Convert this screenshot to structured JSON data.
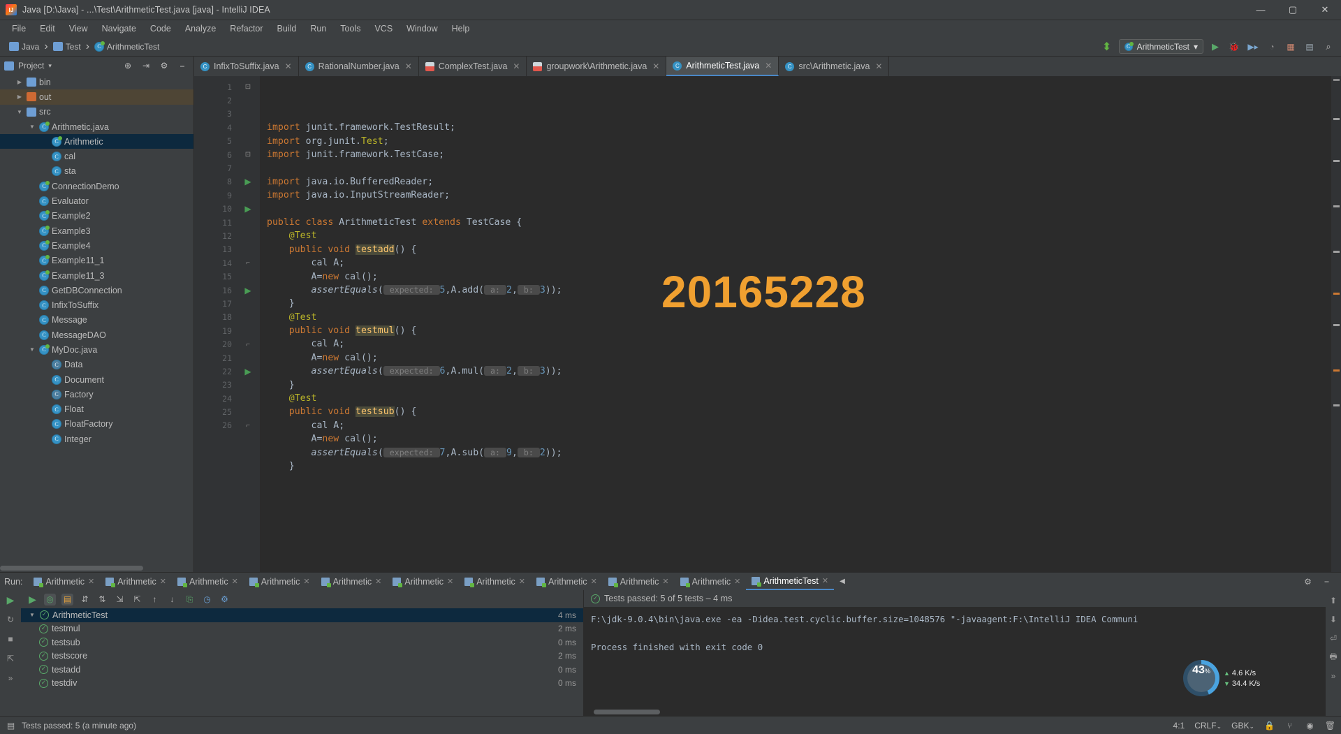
{
  "window": {
    "title": "Java [D:\\Java] - ...\\Test\\ArithmeticTest.java [java] - IntelliJ IDEA",
    "minimize": "—",
    "maximize": "▢",
    "close": "✕"
  },
  "menubar": [
    "File",
    "Edit",
    "View",
    "Navigate",
    "Code",
    "Analyze",
    "Refactor",
    "Build",
    "Run",
    "Tools",
    "VCS",
    "Window",
    "Help"
  ],
  "navbar": {
    "crumbs": [
      "Java",
      "Test",
      "ArithmeticTest"
    ],
    "separator": "›",
    "run_config": "ArithmeticTest",
    "run_config_caret": "▾"
  },
  "project_panel": {
    "title": "Project",
    "title_caret": "▾",
    "tree": [
      {
        "label": "bin",
        "depth": 1,
        "icon": "folder-blue",
        "arrow": "▶",
        "state": "normal"
      },
      {
        "label": "out",
        "depth": 1,
        "icon": "folder-orange",
        "arrow": "▶",
        "state": "tan"
      },
      {
        "label": "src",
        "depth": 1,
        "icon": "folder-blue",
        "arrow": "▼",
        "state": "normal"
      },
      {
        "label": "Arithmetic.java",
        "depth": 2,
        "icon": "class-run",
        "arrow": "▼",
        "state": "normal"
      },
      {
        "label": "Arithmetic",
        "depth": 3,
        "icon": "class-run",
        "arrow": "",
        "state": "selected"
      },
      {
        "label": "cal",
        "depth": 3,
        "icon": "class",
        "arrow": "",
        "state": "normal"
      },
      {
        "label": "sta",
        "depth": 3,
        "icon": "class",
        "arrow": "",
        "state": "normal"
      },
      {
        "label": "ConnectionDemo",
        "depth": 2,
        "icon": "class-run",
        "arrow": "",
        "state": "normal"
      },
      {
        "label": "Evaluator",
        "depth": 2,
        "icon": "class",
        "arrow": "",
        "state": "normal"
      },
      {
        "label": "Example2",
        "depth": 2,
        "icon": "class-run",
        "arrow": "",
        "state": "normal"
      },
      {
        "label": "Example3",
        "depth": 2,
        "icon": "class-run",
        "arrow": "",
        "state": "normal"
      },
      {
        "label": "Example4",
        "depth": 2,
        "icon": "class-run",
        "arrow": "",
        "state": "normal"
      },
      {
        "label": "Example11_1",
        "depth": 2,
        "icon": "class-run",
        "arrow": "",
        "state": "normal"
      },
      {
        "label": "Example11_3",
        "depth": 2,
        "icon": "class-run",
        "arrow": "",
        "state": "normal"
      },
      {
        "label": "GetDBConnection",
        "depth": 2,
        "icon": "class",
        "arrow": "",
        "state": "normal"
      },
      {
        "label": "InfixToSuffix",
        "depth": 2,
        "icon": "class",
        "arrow": "",
        "state": "normal"
      },
      {
        "label": "Message",
        "depth": 2,
        "icon": "class",
        "arrow": "",
        "state": "normal"
      },
      {
        "label": "MessageDAO",
        "depth": 2,
        "icon": "class",
        "arrow": "",
        "state": "normal"
      },
      {
        "label": "MyDoc.java",
        "depth": 2,
        "icon": "class-run",
        "arrow": "▼",
        "state": "normal"
      },
      {
        "label": "Data",
        "depth": 3,
        "icon": "class-dim",
        "arrow": "",
        "state": "normal"
      },
      {
        "label": "Document",
        "depth": 3,
        "icon": "class",
        "arrow": "",
        "state": "normal"
      },
      {
        "label": "Factory",
        "depth": 3,
        "icon": "class-dim",
        "arrow": "",
        "state": "normal"
      },
      {
        "label": "Float",
        "depth": 3,
        "icon": "class",
        "arrow": "",
        "state": "normal"
      },
      {
        "label": "FloatFactory",
        "depth": 3,
        "icon": "class",
        "arrow": "",
        "state": "normal"
      },
      {
        "label": "Integer",
        "depth": 3,
        "icon": "class",
        "arrow": "",
        "state": "normal"
      }
    ]
  },
  "editor": {
    "tabs": [
      {
        "label": "InfixToSuffix.java",
        "icon": "class",
        "active": false,
        "close": "✕"
      },
      {
        "label": "RationalNumber.java",
        "icon": "class",
        "active": false,
        "close": "✕"
      },
      {
        "label": "ComplexTest.java",
        "icon": "junit",
        "active": false,
        "close": "✕"
      },
      {
        "label": "groupwork\\Arithmetic.java",
        "icon": "junit",
        "active": false,
        "close": "✕"
      },
      {
        "label": "ArithmeticTest.java",
        "icon": "class-run",
        "active": true,
        "close": "✕"
      },
      {
        "label": "src\\Arithmetic.java",
        "icon": "class-run",
        "active": false,
        "close": "✕"
      }
    ],
    "watermark": "20165228",
    "line_numbers": [
      "1",
      "2",
      "3",
      "4",
      "5",
      "6",
      "7",
      "8",
      "9",
      "10",
      "11",
      "12",
      "13",
      "14",
      "15",
      "16",
      "17",
      "18",
      "19",
      "20",
      "21",
      "22",
      "23",
      "24",
      "25",
      "26"
    ],
    "lines": [
      {
        "n": 1,
        "tokens": [
          {
            "t": "import ",
            "c": "kw"
          },
          {
            "t": "junit.framework.TestResult;",
            "c": "plain"
          }
        ],
        "underline": true,
        "fold": "collapse-top"
      },
      {
        "n": 2,
        "tokens": [
          {
            "t": "import ",
            "c": "kw"
          },
          {
            "t": "org.junit.",
            "c": "plain"
          },
          {
            "t": "Test",
            "c": "ann"
          },
          {
            "t": ";",
            "c": "plain"
          }
        ]
      },
      {
        "n": 3,
        "tokens": [
          {
            "t": "import ",
            "c": "kw"
          },
          {
            "t": "junit.framework.TestCase;",
            "c": "plain"
          }
        ]
      },
      {
        "n": 4,
        "tokens": []
      },
      {
        "n": 5,
        "tokens": [
          {
            "t": "import ",
            "c": "kw"
          },
          {
            "t": "java.io.BufferedReader;",
            "c": "plain"
          }
        ]
      },
      {
        "n": 6,
        "tokens": [
          {
            "t": "import ",
            "c": "kw"
          },
          {
            "t": "java.io.InputStreamReader;",
            "c": "plain"
          }
        ],
        "fold": "collapse-bottom"
      },
      {
        "n": 7,
        "tokens": []
      },
      {
        "n": 8,
        "tokens": [
          {
            "t": "public class ",
            "c": "kw"
          },
          {
            "t": "ArithmeticTest ",
            "c": "plain"
          },
          {
            "t": "extends ",
            "c": "kw"
          },
          {
            "t": "TestCase {",
            "c": "plain"
          }
        ],
        "runmark": true
      },
      {
        "n": 9,
        "tokens": [
          {
            "t": "    @Test",
            "c": "ann"
          }
        ]
      },
      {
        "n": 10,
        "tokens": [
          {
            "t": "    ",
            "c": "plain"
          },
          {
            "t": "public void ",
            "c": "kw"
          },
          {
            "t": "testadd",
            "c": "hl-mth"
          },
          {
            "t": "() {",
            "c": "plain"
          }
        ],
        "runmark": true,
        "fold": "open"
      },
      {
        "n": 11,
        "tokens": [
          {
            "t": "        cal A;",
            "c": "plain"
          }
        ]
      },
      {
        "n": 12,
        "tokens": [
          {
            "t": "        A=",
            "c": "plain"
          },
          {
            "t": "new ",
            "c": "kw"
          },
          {
            "t": "cal();",
            "c": "plain"
          }
        ]
      },
      {
        "n": 13,
        "tokens": [
          {
            "t": "        ",
            "c": "plain"
          },
          {
            "t": "assertEquals",
            "c": "mth-italic"
          },
          {
            "t": "(",
            "c": "plain"
          },
          {
            "t": " expected: ",
            "c": "hint"
          },
          {
            "t": "5",
            "c": "num"
          },
          {
            "t": ",A.add(",
            "c": "plain"
          },
          {
            "t": " a: ",
            "c": "hint"
          },
          {
            "t": "2",
            "c": "num"
          },
          {
            "t": ",",
            "c": "plain"
          },
          {
            "t": " b: ",
            "c": "hint"
          },
          {
            "t": "3",
            "c": "num"
          },
          {
            "t": "));",
            "c": "plain"
          }
        ]
      },
      {
        "n": 14,
        "tokens": [
          {
            "t": "    }",
            "c": "plain"
          }
        ],
        "fold": "close"
      },
      {
        "n": 15,
        "tokens": [
          {
            "t": "    @Test",
            "c": "ann"
          }
        ]
      },
      {
        "n": 16,
        "tokens": [
          {
            "t": "    ",
            "c": "plain"
          },
          {
            "t": "public void ",
            "c": "kw"
          },
          {
            "t": "testmul",
            "c": "hl-mth"
          },
          {
            "t": "() {",
            "c": "plain"
          }
        ],
        "runmark": true,
        "fold": "open"
      },
      {
        "n": 17,
        "tokens": [
          {
            "t": "        cal A;",
            "c": "plain"
          }
        ]
      },
      {
        "n": 18,
        "tokens": [
          {
            "t": "        A=",
            "c": "plain"
          },
          {
            "t": "new ",
            "c": "kw"
          },
          {
            "t": "cal();",
            "c": "plain"
          }
        ]
      },
      {
        "n": 19,
        "tokens": [
          {
            "t": "        ",
            "c": "plain"
          },
          {
            "t": "assertEquals",
            "c": "mth-italic"
          },
          {
            "t": "(",
            "c": "plain"
          },
          {
            "t": " expected: ",
            "c": "hint"
          },
          {
            "t": "6",
            "c": "num"
          },
          {
            "t": ",A.mul(",
            "c": "plain"
          },
          {
            "t": " a: ",
            "c": "hint"
          },
          {
            "t": "2",
            "c": "num"
          },
          {
            "t": ",",
            "c": "plain"
          },
          {
            "t": " b: ",
            "c": "hint"
          },
          {
            "t": "3",
            "c": "num"
          },
          {
            "t": "));",
            "c": "plain"
          }
        ]
      },
      {
        "n": 20,
        "tokens": [
          {
            "t": "    }",
            "c": "plain"
          }
        ],
        "fold": "close"
      },
      {
        "n": 21,
        "tokens": [
          {
            "t": "    @Test",
            "c": "ann"
          }
        ]
      },
      {
        "n": 22,
        "tokens": [
          {
            "t": "    ",
            "c": "plain"
          },
          {
            "t": "public void ",
            "c": "kw"
          },
          {
            "t": "testsub",
            "c": "hl-mth"
          },
          {
            "t": "() {",
            "c": "plain"
          }
        ],
        "runmark": true,
        "fold": "open"
      },
      {
        "n": 23,
        "tokens": [
          {
            "t": "        cal A;",
            "c": "plain"
          }
        ]
      },
      {
        "n": 24,
        "tokens": [
          {
            "t": "        A=",
            "c": "plain"
          },
          {
            "t": "new ",
            "c": "kw"
          },
          {
            "t": "cal();",
            "c": "plain"
          }
        ]
      },
      {
        "n": 25,
        "tokens": [
          {
            "t": "        ",
            "c": "plain"
          },
          {
            "t": "assertEquals",
            "c": "mth-italic"
          },
          {
            "t": "(",
            "c": "plain"
          },
          {
            "t": " expected: ",
            "c": "hint"
          },
          {
            "t": "7",
            "c": "num"
          },
          {
            "t": ",A.sub(",
            "c": "plain"
          },
          {
            "t": " a: ",
            "c": "hint"
          },
          {
            "t": "9",
            "c": "num"
          },
          {
            "t": ",",
            "c": "plain"
          },
          {
            "t": " b: ",
            "c": "hint"
          },
          {
            "t": "2",
            "c": "num"
          },
          {
            "t": "));",
            "c": "plain"
          }
        ]
      },
      {
        "n": 26,
        "tokens": [
          {
            "t": "    }",
            "c": "plain"
          }
        ],
        "fold": "close"
      }
    ]
  },
  "run_window": {
    "label": "Run:",
    "tabs": [
      {
        "label": "Arithmetic",
        "active": false,
        "close": "✕"
      },
      {
        "label": "Arithmetic",
        "active": false,
        "close": "✕"
      },
      {
        "label": "Arithmetic",
        "active": false,
        "close": "✕"
      },
      {
        "label": "Arithmetic",
        "active": false,
        "close": "✕"
      },
      {
        "label": "Arithmetic",
        "active": false,
        "close": "✕"
      },
      {
        "label": "Arithmetic",
        "active": false,
        "close": "✕"
      },
      {
        "label": "Arithmetic",
        "active": false,
        "close": "✕"
      },
      {
        "label": "Arithmetic",
        "active": false,
        "close": "✕"
      },
      {
        "label": "Arithmetic",
        "active": false,
        "close": "✕"
      },
      {
        "label": "Arithmetic",
        "active": false,
        "close": "✕"
      },
      {
        "label": "ArithmeticTest",
        "active": true,
        "close": "✕"
      }
    ],
    "tabs_more": "◀",
    "test_tree": [
      {
        "label": "ArithmeticTest",
        "time": "4 ms",
        "root": true,
        "arrow": "▼",
        "selected": true
      },
      {
        "label": "testmul",
        "time": "2 ms",
        "root": false,
        "arrow": "",
        "selected": false
      },
      {
        "label": "testsub",
        "time": "0 ms",
        "root": false,
        "arrow": "",
        "selected": false
      },
      {
        "label": "testscore",
        "time": "2 ms",
        "root": false,
        "arrow": "",
        "selected": false
      },
      {
        "label": "testadd",
        "time": "0 ms",
        "root": false,
        "arrow": "",
        "selected": false
      },
      {
        "label": "testdiv",
        "time": "0 ms",
        "root": false,
        "arrow": "",
        "selected": false
      }
    ],
    "console_header": "Tests passed: 5 of 5 tests – 4 ms",
    "console_lines": [
      "F:\\jdk-9.0.4\\bin\\java.exe -ea -Didea.test.cyclic.buffer.size=1048576 \"-javaagent:F:\\IntelliJ IDEA Communi",
      "",
      "Process finished with exit code 0"
    ]
  },
  "network_widget": {
    "percent": "43",
    "percent_suffix": "%",
    "upload": "4.6 K/s",
    "download": "34.4 K/s",
    "up_arrow": "▲",
    "down_arrow": "▼"
  },
  "statusbar": {
    "message": "Tests passed: 5 (a minute ago)",
    "caret_position": "4:1",
    "line_separator": "CRLF",
    "encoding": "GBK",
    "separator_caret": "⌄"
  },
  "colors": {
    "accent_blue": "#4a88c7",
    "watermark_orange": "#f0a030",
    "pass_green": "#59a869",
    "panel_bg": "#3c3f41",
    "editor_bg": "#2b2b2b"
  }
}
